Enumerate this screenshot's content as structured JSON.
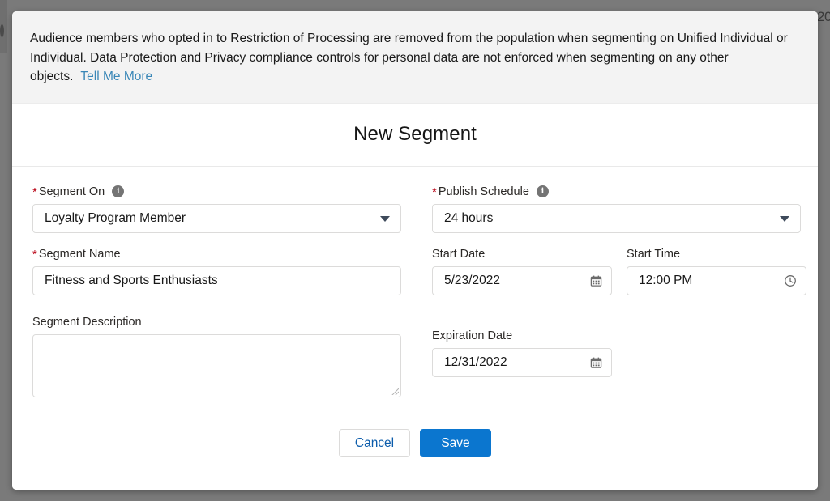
{
  "backdrop": {
    "edge_right_text": "20"
  },
  "banner": {
    "text": "Audience members who opted in to Restriction of Processing are removed from the population when segmenting on Unified Individual or Individual. Data Protection and Privacy compliance controls for personal data are not enforced when segmenting on any other objects.",
    "link_label": "Tell Me More",
    "link_color": "#3a87b7",
    "background": "#f3f3f3"
  },
  "header": {
    "title": "New Segment"
  },
  "form": {
    "segment_on": {
      "label": "Segment On",
      "required_marker": "*",
      "info_icon": "info-icon",
      "value": "Loyalty Program Member"
    },
    "segment_name": {
      "label": "Segment Name",
      "required_marker": "*",
      "value": "Fitness and Sports Enthusiasts",
      "placeholder": ""
    },
    "segment_description": {
      "label": "Segment Description",
      "value": "",
      "placeholder": ""
    },
    "publish_schedule": {
      "label": "Publish Schedule",
      "required_marker": "*",
      "info_icon": "info-icon",
      "value": "24 hours"
    },
    "start_date": {
      "label": "Start Date",
      "value": "5/23/2022",
      "icon": "calendar-icon"
    },
    "start_time": {
      "label": "Start Time",
      "value": "12:00 PM",
      "icon": "clock-icon"
    },
    "expiration_date": {
      "label": "Expiration Date",
      "value": "12/31/2022",
      "icon": "calendar-icon"
    }
  },
  "footer": {
    "cancel_label": "Cancel",
    "save_label": "Save",
    "save_color": "#0b76cf"
  }
}
